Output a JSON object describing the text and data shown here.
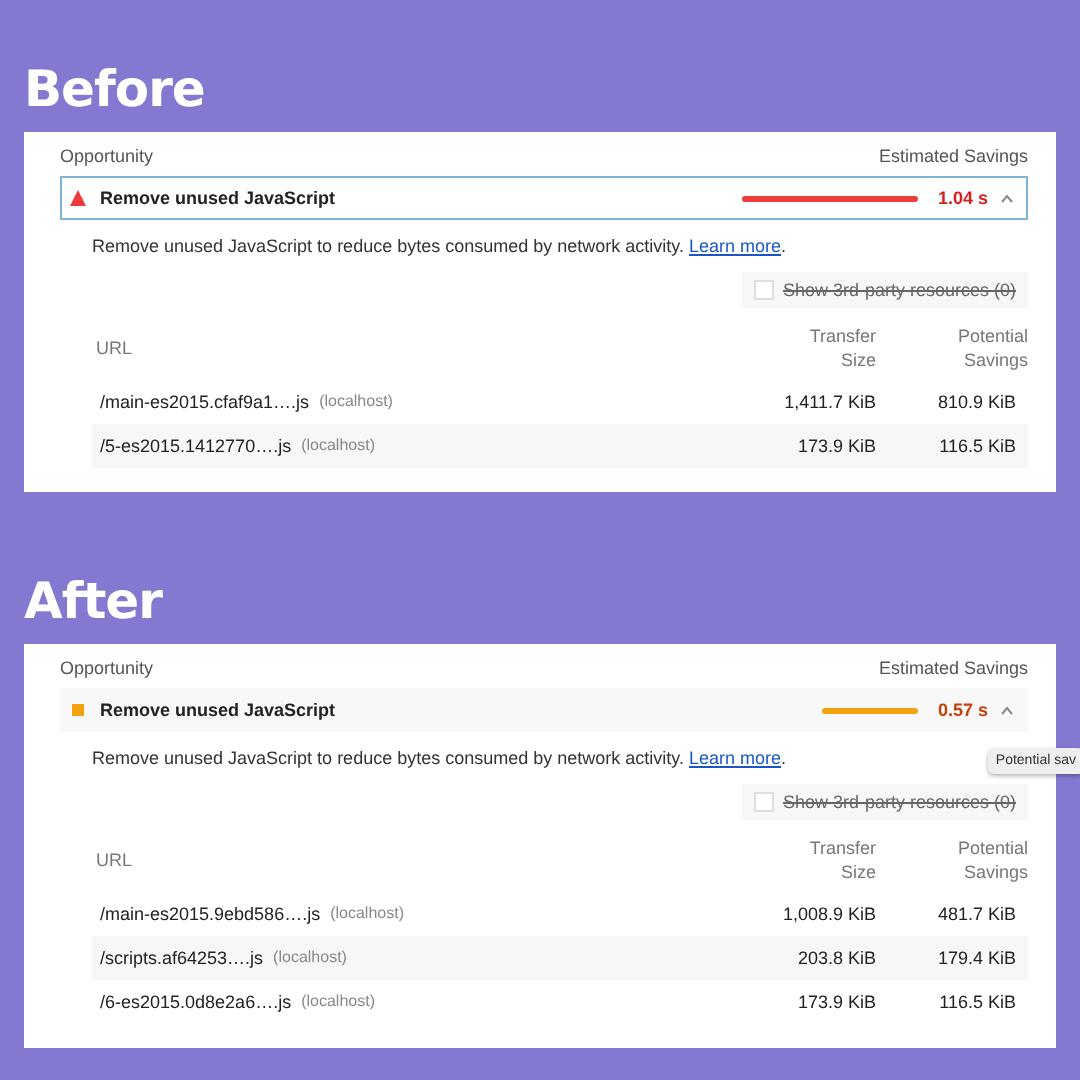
{
  "sections": [
    {
      "heading": "Before",
      "columns": {
        "left": "Opportunity",
        "right": "Estimated Savings"
      },
      "audit": {
        "title": "Remove unused JavaScript",
        "kind": "fail",
        "focused": true,
        "savings": "1.04 s",
        "expanded": true
      },
      "description": "Remove unused JavaScript to reduce bytes consumed by network activity.",
      "link": "Learn more",
      "after_link": ".",
      "third_party": {
        "label": "Show 3rd-party resources (0)",
        "checked": false,
        "disabled": true
      },
      "table": {
        "columns": [
          "URL",
          "Transfer Size",
          "Potential Savings"
        ],
        "rows": [
          {
            "url": "/main-es2015.cfaf9a1….js",
            "host": "(localhost)",
            "size": "1,411.7 KiB",
            "savings": "810.9 KiB"
          },
          {
            "url": "/5-es2015.1412770….js",
            "host": "(localhost)",
            "size": "173.9 KiB",
            "savings": "116.5 KiB"
          }
        ]
      }
    },
    {
      "heading": "After",
      "columns": {
        "left": "Opportunity",
        "right": "Estimated Savings"
      },
      "audit": {
        "title": "Remove unused JavaScript",
        "kind": "average",
        "focused": false,
        "savings": "0.57 s",
        "expanded": true
      },
      "description": "Remove unused JavaScript to reduce bytes consumed by network activity.",
      "link": "Learn more",
      "after_link": ".",
      "tooltip": "Potential sav",
      "third_party": {
        "label": "Show 3rd-party resources (0)",
        "checked": false,
        "disabled": true
      },
      "table": {
        "columns": [
          "URL",
          "Transfer Size",
          "Potential Savings"
        ],
        "rows": [
          {
            "url": "/main-es2015.9ebd586….js",
            "host": "(localhost)",
            "size": "1,008.9 KiB",
            "savings": "481.7 KiB"
          },
          {
            "url": "/scripts.af64253….js",
            "host": "(localhost)",
            "size": "203.8 KiB",
            "savings": "179.4 KiB"
          },
          {
            "url": "/6-es2015.0d8e2a6….js",
            "host": "(localhost)",
            "size": "173.9 KiB",
            "savings": "116.5 KiB"
          }
        ]
      }
    }
  ]
}
